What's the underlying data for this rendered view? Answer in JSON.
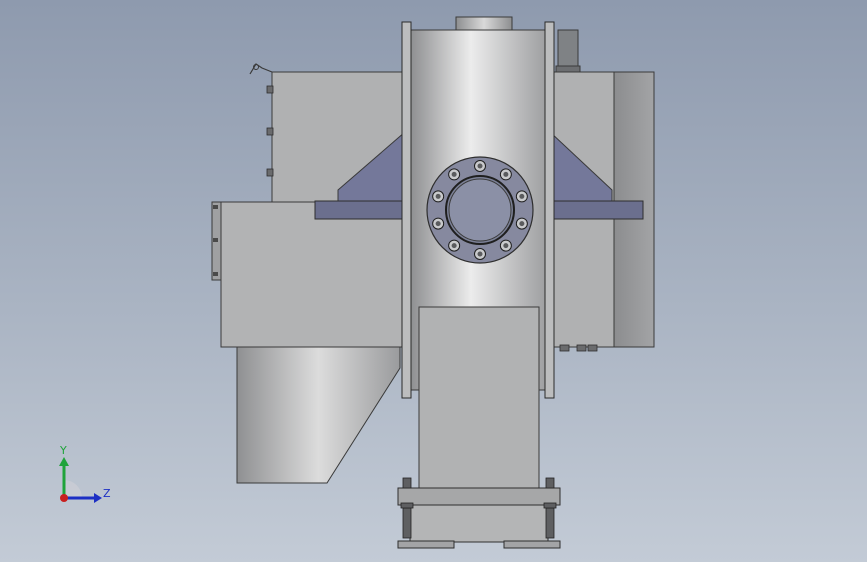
{
  "viewport": {
    "background_top": "#8e9aae",
    "background_bottom": "#c3cbd6"
  },
  "triad": {
    "y_label": "Y",
    "z_label": "Z",
    "y_color": "#1fa33a",
    "z_color": "#1c2fc4",
    "origin_color": "#c81f1f"
  },
  "model": {
    "body_color": "#a9aaab",
    "panel_color": "#bfc0c1",
    "steel_dark": "#6e7290",
    "bolt_count": 10
  }
}
